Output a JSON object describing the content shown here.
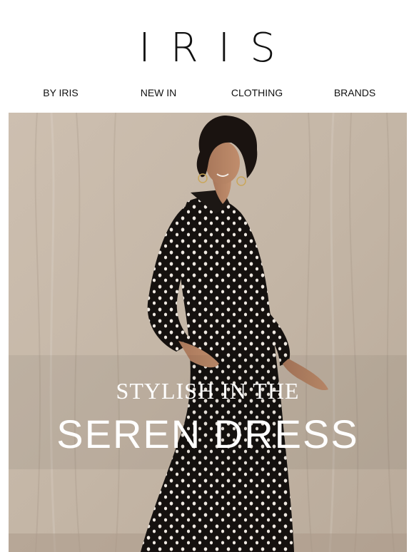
{
  "brand": {
    "logo_text": "IRIS"
  },
  "nav": {
    "items": [
      {
        "label": "BY IRIS"
      },
      {
        "label": "NEW IN"
      },
      {
        "label": "CLOTHING"
      },
      {
        "label": "BRANDS"
      }
    ]
  },
  "hero": {
    "subtitle": "STYLISH IN THE",
    "title": "SEREN DRESS"
  },
  "colors": {
    "background": "#ffffff",
    "text": "#111111",
    "hero_backdrop": "#c9bcae",
    "dress": "#15110f",
    "dots": "#efe9e2",
    "hero_text": "#ffffff"
  },
  "icons": {
    "hero_image": "woman-polka-dot-dress-photo"
  }
}
